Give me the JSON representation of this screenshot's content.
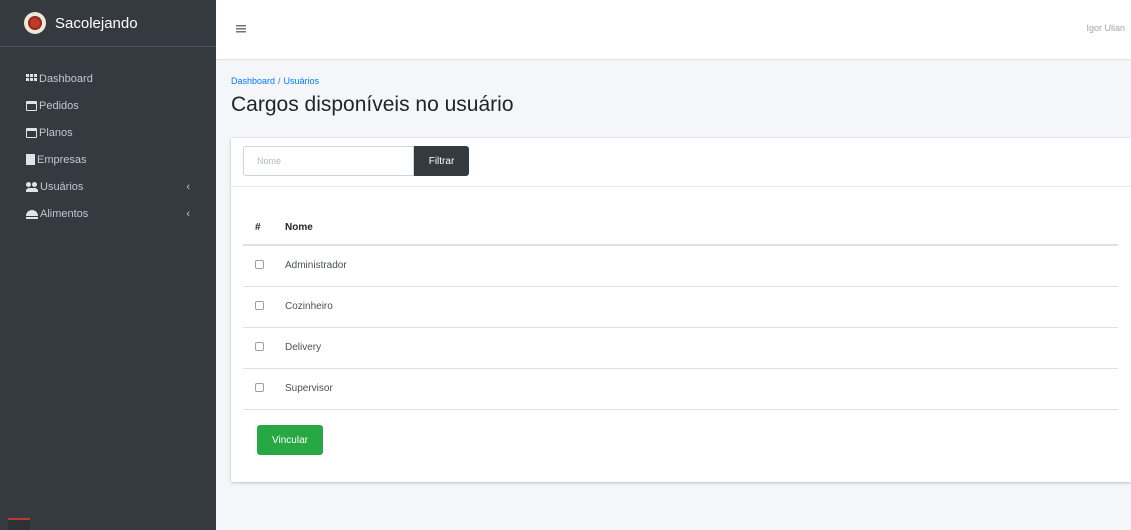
{
  "sidebar": {
    "brand": "Sacolejando",
    "items": [
      {
        "label": "Dashboard",
        "icon": "dashboard-grid-icon"
      },
      {
        "label": "Pedidos",
        "icon": "calendar-icon"
      },
      {
        "label": "Planos",
        "icon": "calendar-icon"
      },
      {
        "label": "Empresas",
        "icon": "building-icon"
      },
      {
        "label": "Usuários",
        "icon": "users-icon",
        "chevron": "‹"
      },
      {
        "label": "Alimentos",
        "icon": "food-icon",
        "chevron": "‹"
      }
    ]
  },
  "header": {
    "menu_icon": "hamburger-icon",
    "user_name": "Igor Ulian"
  },
  "breadcrumb": {
    "items": [
      "Dashboard",
      "Usuários"
    ],
    "separator": "/"
  },
  "page": {
    "title": "Cargos disponíveis no usuário"
  },
  "filter": {
    "placeholder": "Nome",
    "value": "",
    "button_label": "Filtrar"
  },
  "table": {
    "columns": [
      "#",
      "Nome"
    ],
    "rows": [
      {
        "checked": false,
        "name": "Administrador"
      },
      {
        "checked": false,
        "name": "Cozinheiro"
      },
      {
        "checked": false,
        "name": "Delivery"
      },
      {
        "checked": false,
        "name": "Supervisor"
      }
    ]
  },
  "actions": {
    "link_label": "Vincular"
  },
  "colors": {
    "sidebar_bg": "#343a40",
    "primary_link": "#007bff",
    "success": "#28a745",
    "dark_button": "#343a40"
  }
}
